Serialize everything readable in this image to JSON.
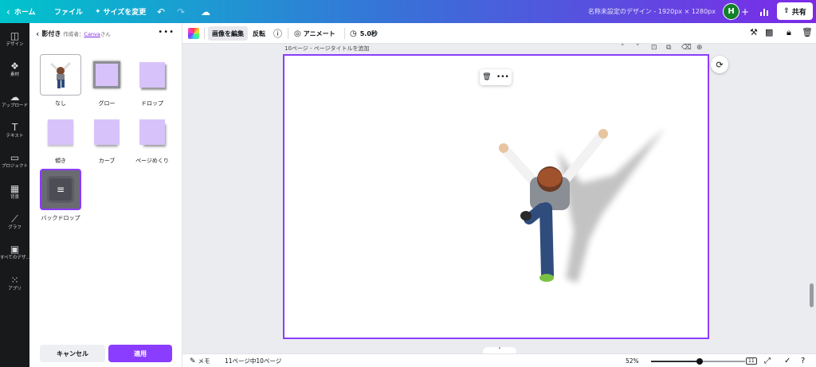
{
  "topbar": {
    "home_label": "ホーム",
    "file_label": "ファイル",
    "resize_label": "サイズを変更",
    "title": "名称未設定のデザイン - 1920px × 1280px",
    "avatar_initial": "H",
    "share_label": "共有"
  },
  "rail": {
    "items": [
      {
        "label": "デザイン",
        "icon": "layout-icon"
      },
      {
        "label": "素材",
        "icon": "elements-icon"
      },
      {
        "label": "アップロード",
        "icon": "upload-icon"
      },
      {
        "label": "テキスト",
        "icon": "text-icon"
      },
      {
        "label": "プロジェクト",
        "icon": "folder-icon"
      },
      {
        "label": "背景",
        "icon": "background-icon"
      },
      {
        "label": "グラフ",
        "icon": "chart-icon"
      },
      {
        "label": "すべてのデザ...",
        "icon": "grid-icon"
      },
      {
        "label": "アプリ",
        "icon": "apps-icon"
      }
    ]
  },
  "panel": {
    "title": "影付き",
    "author_prefix": "作成者：",
    "author": "Canva",
    "author_suffix": "さん",
    "effects": [
      {
        "label": "なし"
      },
      {
        "label": "グロー"
      },
      {
        "label": "ドロップ"
      },
      {
        "label": "傾き"
      },
      {
        "label": "カーブ"
      },
      {
        "label": "ページめくり"
      },
      {
        "label": "バックドロップ"
      }
    ],
    "cancel_label": "キャンセル",
    "apply_label": "適用"
  },
  "toolbar": {
    "edit_image_label": "画像を編集",
    "flip_label": "反転",
    "animate_label": "アニメート",
    "duration": "5.0秒"
  },
  "canvas": {
    "page_label": "10ページ - ページタイトルを追加"
  },
  "footer": {
    "notes_label": "メモ",
    "page_count": "11ページ中10ページ",
    "zoom": "52%",
    "zoom_level": 0.52,
    "pages_badge": "11"
  },
  "colors": {
    "accent": "#8b3dff",
    "rail_bg": "#18191b",
    "effect_swatch": "#d7c3f9"
  }
}
